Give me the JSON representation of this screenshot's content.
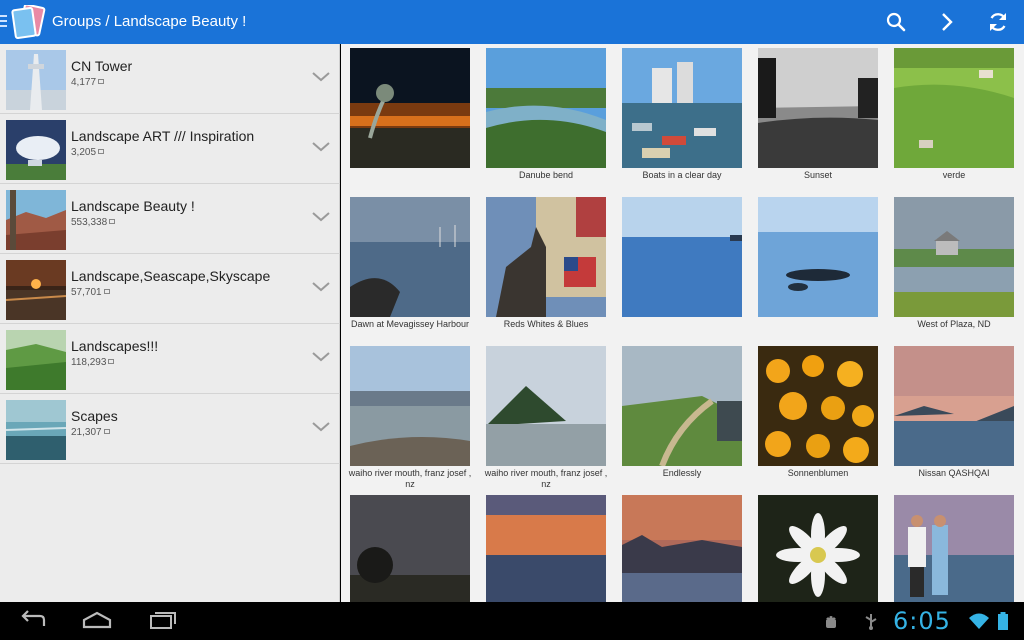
{
  "app": {
    "title": "Groups / Landscape Beauty !",
    "accent": "#1a73d8",
    "icons": [
      "app-logo-icon",
      "search-icon",
      "chevron-right-icon",
      "refresh-icon"
    ]
  },
  "groups": [
    {
      "name": "CN Tower",
      "count": "4,177"
    },
    {
      "name": "Landscape ART /// Inspiration",
      "count": "3,205"
    },
    {
      "name": "Landscape Beauty !",
      "count": "553,338"
    },
    {
      "name": "Landscape,Seascape,Skyscape",
      "count": "57,701"
    },
    {
      "name": "Landscapes!!!",
      "count": "118,293"
    },
    {
      "name": "Scapes",
      "count": "21,307"
    }
  ],
  "photos": [
    {
      "caption": ""
    },
    {
      "caption": "Danube bend"
    },
    {
      "caption": "Boats in a clear day"
    },
    {
      "caption": "Sunset"
    },
    {
      "caption": "verde"
    },
    {
      "caption": "Dawn at Mevagissey Harbour"
    },
    {
      "caption": "Reds Whites & Blues"
    },
    {
      "caption": ""
    },
    {
      "caption": ""
    },
    {
      "caption": "West of Plaza, ND"
    },
    {
      "caption": "waiho river mouth, franz josef , nz"
    },
    {
      "caption": "waiho river mouth, franz josef , nz"
    },
    {
      "caption": "Endlessly"
    },
    {
      "caption": "Sonnenblumen"
    },
    {
      "caption": "Nissan QASHQAI"
    },
    {
      "caption": ""
    },
    {
      "caption": ""
    },
    {
      "caption": ""
    },
    {
      "caption": ""
    },
    {
      "caption": ""
    }
  ],
  "system": {
    "clock": "6:05",
    "clock_color": "#35b3e5",
    "nav_icons": [
      "back-icon",
      "home-icon",
      "recent-apps-icon"
    ],
    "status_icons": [
      "android-debug-icon",
      "usb-icon",
      "wifi-icon",
      "battery-icon"
    ]
  }
}
